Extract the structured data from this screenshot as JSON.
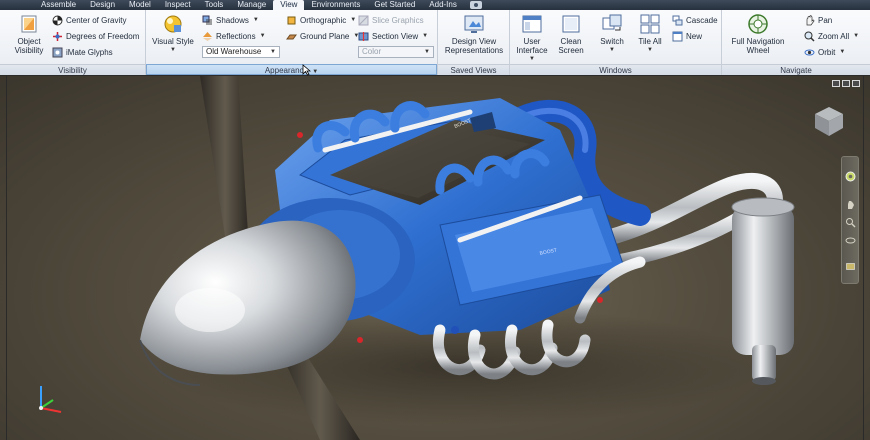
{
  "menu_tabs": [
    {
      "label": "Assemble",
      "active": false,
      "dim": false
    },
    {
      "label": "Design",
      "active": false,
      "dim": false
    },
    {
      "label": "Model",
      "active": false,
      "dim": false
    },
    {
      "label": "Inspect",
      "active": false,
      "dim": false
    },
    {
      "label": "Tools",
      "active": false,
      "dim": false
    },
    {
      "label": "Manage",
      "active": false,
      "dim": false
    },
    {
      "label": "View",
      "active": true,
      "dim": false
    },
    {
      "label": "Environments",
      "active": false,
      "dim": false
    },
    {
      "label": "Get Started",
      "active": false,
      "dim": false
    },
    {
      "label": "Add-Ins",
      "active": false,
      "dim": false
    }
  ],
  "ribbon": {
    "visibility": {
      "title": "Visibility",
      "object_visibility": "Object Visibility",
      "center_of_gravity": "Center of Gravity",
      "degrees_of_freedom": "Degrees of Freedom",
      "imate_glyphs": "iMate Glyphs"
    },
    "appearance": {
      "title": "Appearance",
      "visual_style": "Visual Style",
      "shadows": "Shadows",
      "reflections": "Reflections",
      "orthographic": "Orthographic",
      "ground_plane": "Ground Plane",
      "slice_graphics": "Slice Graphics",
      "section_view": "Section View",
      "lighting_style": "Old Warehouse",
      "color": "Color"
    },
    "saved_views": {
      "title": "Saved Views",
      "design_view": "Design View Representations"
    },
    "windows": {
      "title": "Windows",
      "user_interface": "User Interface",
      "clean_screen": "Clean Screen",
      "switch": "Switch",
      "tile_all": "Tile All",
      "cascade": "Cascade",
      "new": "New"
    },
    "navigate": {
      "title": "Navigate",
      "full_nav_wheel": "Full Navigation Wheel",
      "pan": "Pan",
      "zoom_all": "Zoom All",
      "orbit": "Orbit"
    }
  },
  "model": {
    "plate_text_1": "BOOST",
    "plate_text_2": "BOOST",
    "cover_badge": "BOOST"
  },
  "colors": {
    "engine_blue": "#2f6fd0",
    "chrome": "#cfd3d6",
    "carbon": "#3a3630",
    "accent": "#2b4f8a"
  }
}
